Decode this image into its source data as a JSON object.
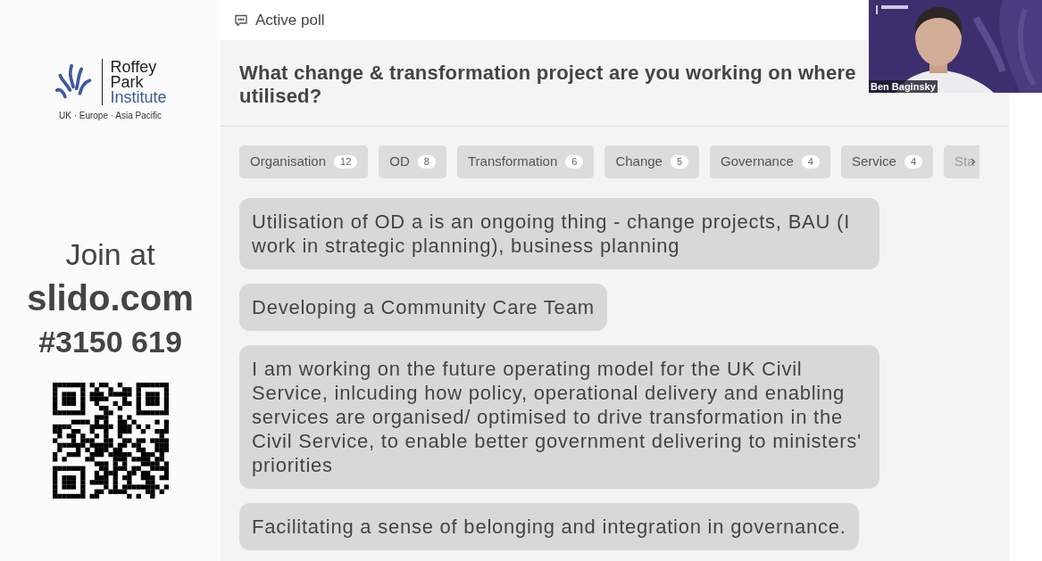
{
  "sidebar": {
    "logo": {
      "lines": [
        "Roffey",
        "Park",
        "Institute"
      ],
      "tagline": "UK · Europe · Asia Pacific"
    },
    "join_label": "Join at",
    "site": "slido.com",
    "code": "#3150 619"
  },
  "header": {
    "title": "Active poll"
  },
  "question": {
    "lines": [
      "What change & transformation project are you working on where",
      "utilised?"
    ]
  },
  "tags": [
    {
      "label": "Organisation",
      "count": "12"
    },
    {
      "label": "OD",
      "count": "8"
    },
    {
      "label": "Transformation",
      "count": "6"
    },
    {
      "label": "Change",
      "count": "5"
    },
    {
      "label": "Governance",
      "count": "4"
    },
    {
      "label": "Service",
      "count": "4"
    },
    {
      "label": "Sta"
    }
  ],
  "answers": [
    "Utilisation of OD a is an ongoing thing - change projects, BAU (I work in strategic planning), business planning",
    "Developing a Community Care Team",
    "I am working on the future operating model for the UK Civil Service, inlcuding how policy, operational delivery and enabling services are organised/ optimised to drive transformation in the Civil Service, to enable better government delivering to ministers' priorities",
    "Facilitating a sense of belonging and integration in governance."
  ],
  "video": {
    "name": "Ben Baginsky"
  }
}
